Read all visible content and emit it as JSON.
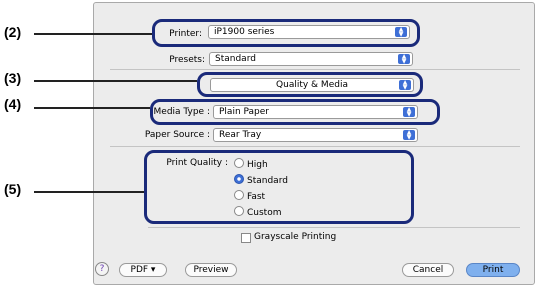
{
  "markers": [
    "(2)",
    "(3)",
    "(4)",
    "(5)"
  ],
  "printer": {
    "label": "Printer:",
    "value": "iP1900 series"
  },
  "presets": {
    "label": "Presets:",
    "value": "Standard"
  },
  "panel": {
    "value": "Quality & Media"
  },
  "media_type": {
    "label": "Media Type :",
    "value": "Plain Paper"
  },
  "paper_source": {
    "label": "Paper Source :",
    "value": "Rear Tray"
  },
  "print_quality": {
    "label": "Print Quality :",
    "options": [
      "High",
      "Standard",
      "Fast",
      "Custom"
    ],
    "selected": "Standard"
  },
  "grayscale": {
    "label": "Grayscale Printing",
    "checked": false
  },
  "footer": {
    "help": "?",
    "pdf": "PDF ▾",
    "preview": "Preview",
    "cancel": "Cancel",
    "print": "Print"
  }
}
